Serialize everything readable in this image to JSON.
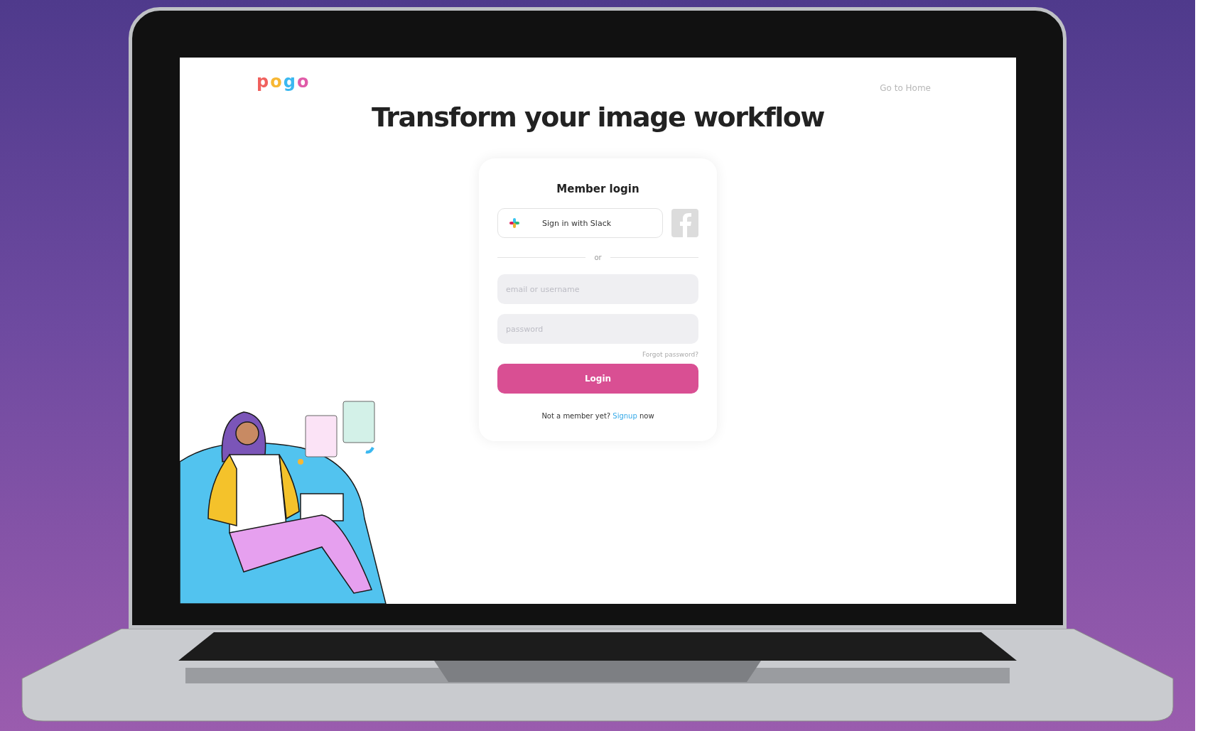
{
  "logo": {
    "letters": [
      {
        "char": "p",
        "color": "#f0605d"
      },
      {
        "char": "o",
        "color": "#f7b733"
      },
      {
        "char": "g",
        "color": "#3bb8f0"
      },
      {
        "char": "o",
        "color": "#e05aa8"
      }
    ]
  },
  "nav": {
    "link": "Go to Home"
  },
  "headline": "Transform your image workflow",
  "login": {
    "title": "Member login",
    "slack_button": "Sign in with Slack",
    "divider": "or",
    "email_placeholder": "email or username",
    "password_placeholder": "password",
    "forgot": "Forgot password?",
    "submit": "Login",
    "signup": {
      "before": "Not a member yet?",
      "link": "Signup",
      "after": "now"
    }
  }
}
